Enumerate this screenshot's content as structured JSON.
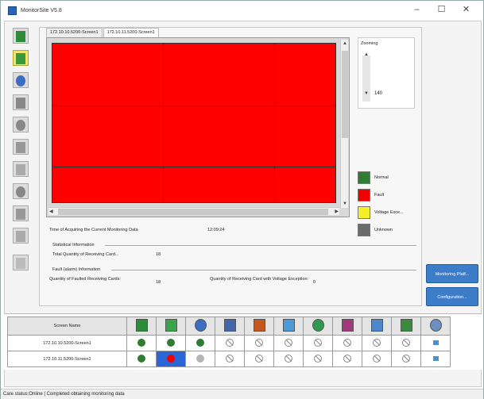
{
  "window": {
    "title": "MonitorSite V5.8",
    "controls": [
      "–",
      "☐",
      "✕"
    ]
  },
  "tabs": [
    {
      "label": "172.10.10.5200-Screen1",
      "selected": false
    },
    {
      "label": "172.10.11.5200-Screen1",
      "selected": true
    }
  ],
  "zooming": {
    "label": "Zooming",
    "value": "140"
  },
  "legend": [
    {
      "label": "Normal",
      "color": "#2e7d32"
    },
    {
      "label": "Fault",
      "color": "#f00000"
    },
    {
      "label": "Voltage Exce...",
      "color": "#f5ef2a"
    },
    {
      "label": "Unknown",
      "color": "#6b6b6b"
    }
  ],
  "monitoring": {
    "time_label": "Time of Acquiring the Current Monitoring Data",
    "time_value": "12:09:24"
  },
  "statistical": {
    "section": "Statistical Information",
    "total_label": "Total Quantity of Receiving Card...",
    "total_value": "18"
  },
  "fault": {
    "section": "Fault (alarm) Information",
    "faulted_label": "Quantity of Faulted Receiving Cards:",
    "faulted_value": "18",
    "voltage_label": "Quantity of Receiving Card with Voltage Exception:",
    "voltage_value": "0"
  },
  "side_buttons": {
    "monitoring_platform": "Monitoring Platf...",
    "configuration": "Configuration..."
  },
  "table": {
    "name_header": "Screen Name",
    "header_icons": [
      "receiving-card-icon",
      "module-icon",
      "temperature-icon",
      "humidity-icon",
      "smoke-icon",
      "fan-icon",
      "voltage-icon",
      "magnet-icon",
      "port-icon",
      "monitor-card-icon",
      "network-icon"
    ],
    "rows": [
      {
        "name": "172.10.10.5200-Screen1",
        "cells": [
          "green",
          "green",
          "green",
          "ban",
          "ban",
          "ban",
          "ban",
          "ban",
          "ban",
          "ban",
          "mini"
        ]
      },
      {
        "name": "172.10.11.5200-Screen1",
        "cells": [
          "green",
          "red-highlight",
          "grey",
          "ban",
          "ban",
          "ban",
          "ban",
          "ban",
          "ban",
          "ban",
          "mini"
        ]
      }
    ]
  },
  "status": {
    "text": "Care status:Online  |  Completed obtaining monitoring data"
  },
  "colors": {
    "fault": "#f00000",
    "normal": "#2e7d32",
    "accent_button": "#3d7cc9"
  }
}
